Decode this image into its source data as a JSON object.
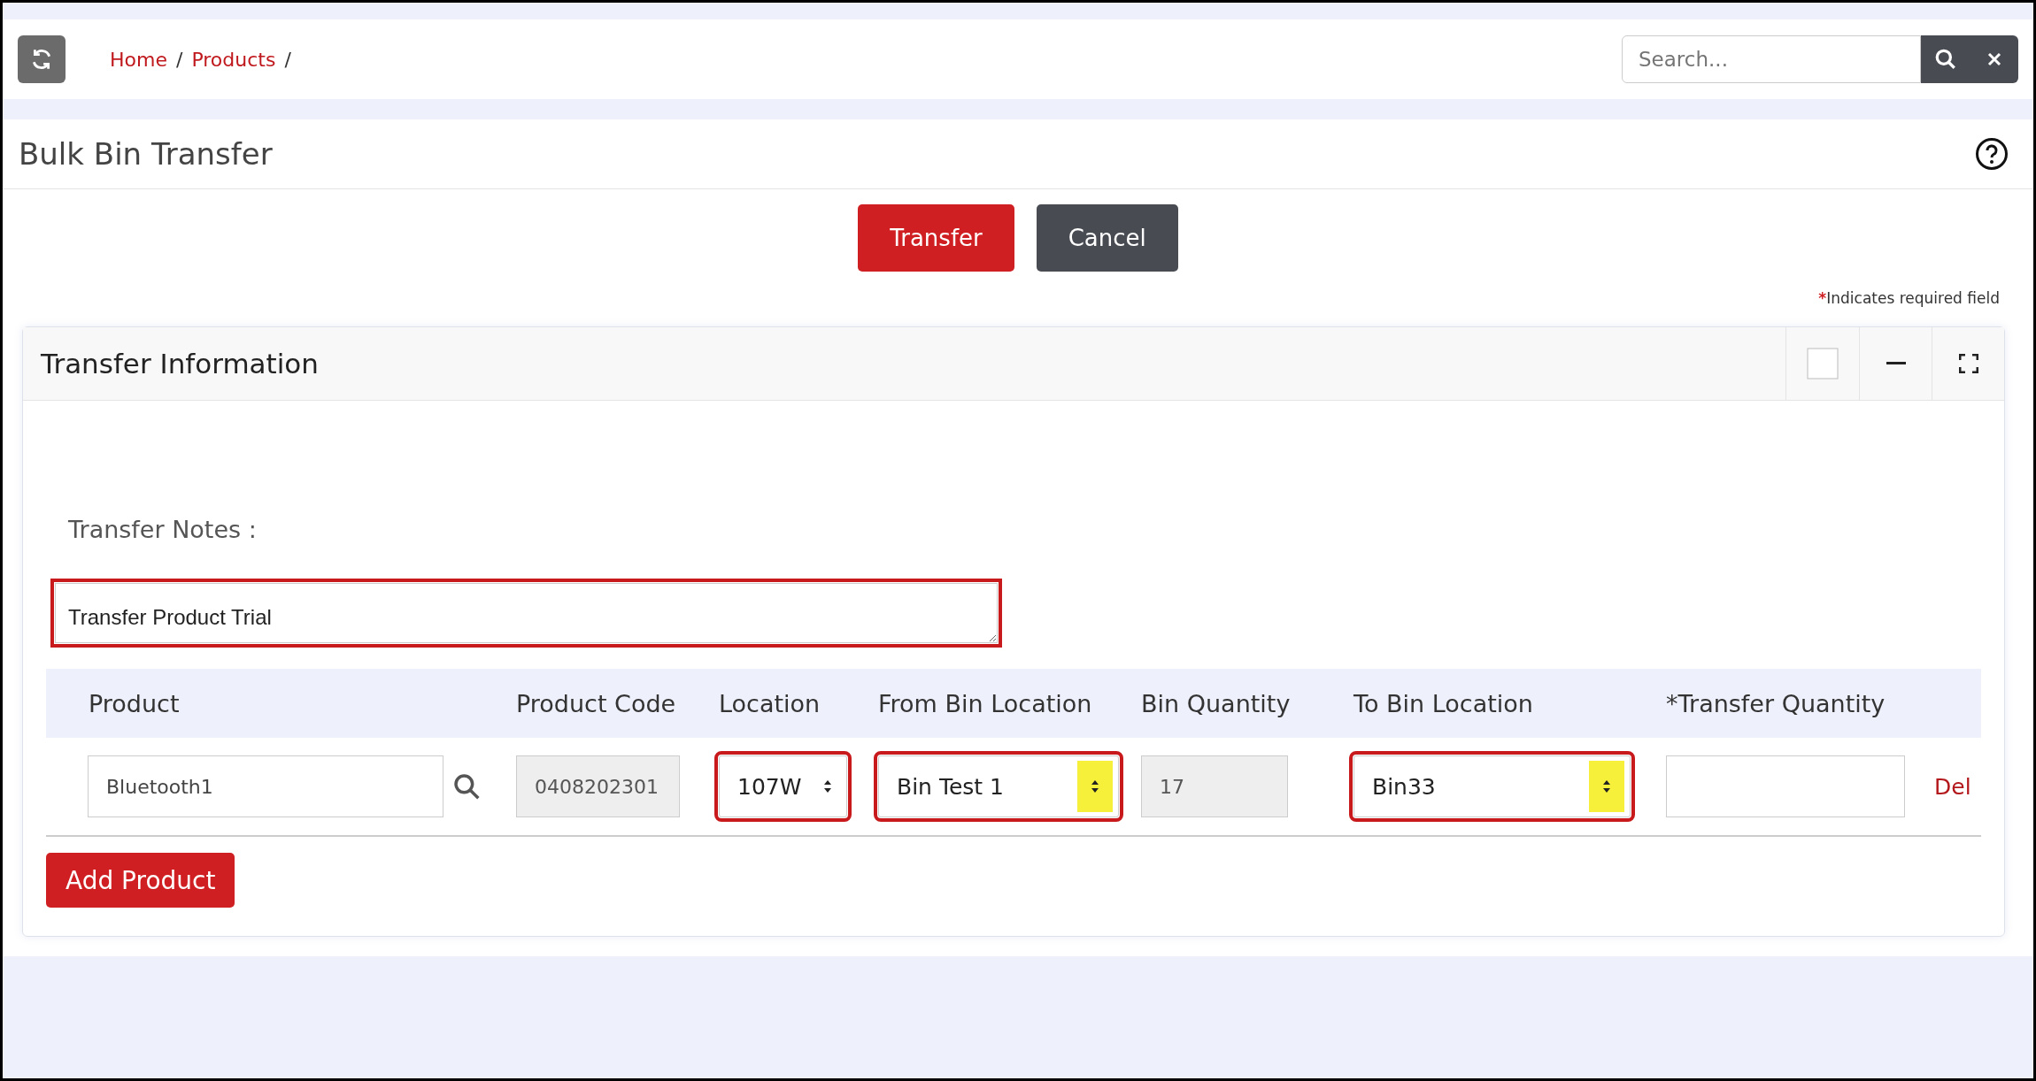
{
  "breadcrumb": [
    {
      "label": "Home",
      "separator": "/"
    },
    {
      "label": "Products",
      "separator": "/"
    }
  ],
  "search": {
    "placeholder": "Search..."
  },
  "page_title": "Bulk Bin Transfer",
  "actions": [
    {
      "label": "Transfer",
      "kind": "primary"
    },
    {
      "label": "Cancel",
      "kind": "secondary"
    }
  ],
  "required_note": {
    "mark": "*",
    "text": "Indicates required field"
  },
  "card": {
    "title": "Transfer Information",
    "checkbox": {
      "checked": false
    },
    "notes": {
      "label": "Transfer Notes :",
      "value": "Transfer Product Trial",
      "highlighted": true
    },
    "table": {
      "columns": [
        "Product",
        "Product Code",
        "Location",
        "From Bin Location",
        "Bin Quantity",
        "To Bin Location",
        "*Transfer Quantity"
      ],
      "rows": [
        {
          "product": "Bluetooth1",
          "product_code": "0408202301",
          "location": {
            "value": "107W",
            "highlighted": true,
            "spinner_highlighted": false
          },
          "from_bin": {
            "value": "Bin Test 1",
            "highlighted": true,
            "spinner_highlighted": true
          },
          "bin_quantity": "17",
          "to_bin": {
            "value": "Bin33",
            "highlighted": true,
            "spinner_highlighted": true
          },
          "delete": "Del"
        }
      ]
    },
    "add_button": "Add Product"
  }
}
